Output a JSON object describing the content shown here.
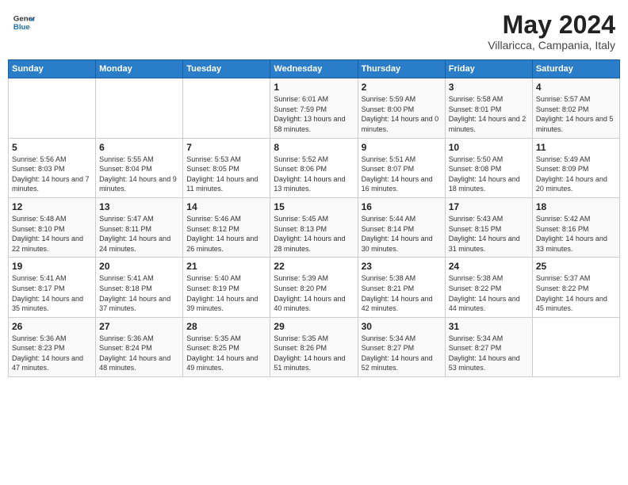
{
  "logo": {
    "general": "General",
    "blue": "Blue"
  },
  "title": "May 2024",
  "subtitle": "Villaricca, Campania, Italy",
  "headers": [
    "Sunday",
    "Monday",
    "Tuesday",
    "Wednesday",
    "Thursday",
    "Friday",
    "Saturday"
  ],
  "weeks": [
    [
      {
        "day": "",
        "sunrise": "",
        "sunset": "",
        "daylight": ""
      },
      {
        "day": "",
        "sunrise": "",
        "sunset": "",
        "daylight": ""
      },
      {
        "day": "",
        "sunrise": "",
        "sunset": "",
        "daylight": ""
      },
      {
        "day": "1",
        "sunrise": "Sunrise: 6:01 AM",
        "sunset": "Sunset: 7:59 PM",
        "daylight": "Daylight: 13 hours and 58 minutes."
      },
      {
        "day": "2",
        "sunrise": "Sunrise: 5:59 AM",
        "sunset": "Sunset: 8:00 PM",
        "daylight": "Daylight: 14 hours and 0 minutes."
      },
      {
        "day": "3",
        "sunrise": "Sunrise: 5:58 AM",
        "sunset": "Sunset: 8:01 PM",
        "daylight": "Daylight: 14 hours and 2 minutes."
      },
      {
        "day": "4",
        "sunrise": "Sunrise: 5:57 AM",
        "sunset": "Sunset: 8:02 PM",
        "daylight": "Daylight: 14 hours and 5 minutes."
      }
    ],
    [
      {
        "day": "5",
        "sunrise": "Sunrise: 5:56 AM",
        "sunset": "Sunset: 8:03 PM",
        "daylight": "Daylight: 14 hours and 7 minutes."
      },
      {
        "day": "6",
        "sunrise": "Sunrise: 5:55 AM",
        "sunset": "Sunset: 8:04 PM",
        "daylight": "Daylight: 14 hours and 9 minutes."
      },
      {
        "day": "7",
        "sunrise": "Sunrise: 5:53 AM",
        "sunset": "Sunset: 8:05 PM",
        "daylight": "Daylight: 14 hours and 11 minutes."
      },
      {
        "day": "8",
        "sunrise": "Sunrise: 5:52 AM",
        "sunset": "Sunset: 8:06 PM",
        "daylight": "Daylight: 14 hours and 13 minutes."
      },
      {
        "day": "9",
        "sunrise": "Sunrise: 5:51 AM",
        "sunset": "Sunset: 8:07 PM",
        "daylight": "Daylight: 14 hours and 16 minutes."
      },
      {
        "day": "10",
        "sunrise": "Sunrise: 5:50 AM",
        "sunset": "Sunset: 8:08 PM",
        "daylight": "Daylight: 14 hours and 18 minutes."
      },
      {
        "day": "11",
        "sunrise": "Sunrise: 5:49 AM",
        "sunset": "Sunset: 8:09 PM",
        "daylight": "Daylight: 14 hours and 20 minutes."
      }
    ],
    [
      {
        "day": "12",
        "sunrise": "Sunrise: 5:48 AM",
        "sunset": "Sunset: 8:10 PM",
        "daylight": "Daylight: 14 hours and 22 minutes."
      },
      {
        "day": "13",
        "sunrise": "Sunrise: 5:47 AM",
        "sunset": "Sunset: 8:11 PM",
        "daylight": "Daylight: 14 hours and 24 minutes."
      },
      {
        "day": "14",
        "sunrise": "Sunrise: 5:46 AM",
        "sunset": "Sunset: 8:12 PM",
        "daylight": "Daylight: 14 hours and 26 minutes."
      },
      {
        "day": "15",
        "sunrise": "Sunrise: 5:45 AM",
        "sunset": "Sunset: 8:13 PM",
        "daylight": "Daylight: 14 hours and 28 minutes."
      },
      {
        "day": "16",
        "sunrise": "Sunrise: 5:44 AM",
        "sunset": "Sunset: 8:14 PM",
        "daylight": "Daylight: 14 hours and 30 minutes."
      },
      {
        "day": "17",
        "sunrise": "Sunrise: 5:43 AM",
        "sunset": "Sunset: 8:15 PM",
        "daylight": "Daylight: 14 hours and 31 minutes."
      },
      {
        "day": "18",
        "sunrise": "Sunrise: 5:42 AM",
        "sunset": "Sunset: 8:16 PM",
        "daylight": "Daylight: 14 hours and 33 minutes."
      }
    ],
    [
      {
        "day": "19",
        "sunrise": "Sunrise: 5:41 AM",
        "sunset": "Sunset: 8:17 PM",
        "daylight": "Daylight: 14 hours and 35 minutes."
      },
      {
        "day": "20",
        "sunrise": "Sunrise: 5:41 AM",
        "sunset": "Sunset: 8:18 PM",
        "daylight": "Daylight: 14 hours and 37 minutes."
      },
      {
        "day": "21",
        "sunrise": "Sunrise: 5:40 AM",
        "sunset": "Sunset: 8:19 PM",
        "daylight": "Daylight: 14 hours and 39 minutes."
      },
      {
        "day": "22",
        "sunrise": "Sunrise: 5:39 AM",
        "sunset": "Sunset: 8:20 PM",
        "daylight": "Daylight: 14 hours and 40 minutes."
      },
      {
        "day": "23",
        "sunrise": "Sunrise: 5:38 AM",
        "sunset": "Sunset: 8:21 PM",
        "daylight": "Daylight: 14 hours and 42 minutes."
      },
      {
        "day": "24",
        "sunrise": "Sunrise: 5:38 AM",
        "sunset": "Sunset: 8:22 PM",
        "daylight": "Daylight: 14 hours and 44 minutes."
      },
      {
        "day": "25",
        "sunrise": "Sunrise: 5:37 AM",
        "sunset": "Sunset: 8:22 PM",
        "daylight": "Daylight: 14 hours and 45 minutes."
      }
    ],
    [
      {
        "day": "26",
        "sunrise": "Sunrise: 5:36 AM",
        "sunset": "Sunset: 8:23 PM",
        "daylight": "Daylight: 14 hours and 47 minutes."
      },
      {
        "day": "27",
        "sunrise": "Sunrise: 5:36 AM",
        "sunset": "Sunset: 8:24 PM",
        "daylight": "Daylight: 14 hours and 48 minutes."
      },
      {
        "day": "28",
        "sunrise": "Sunrise: 5:35 AM",
        "sunset": "Sunset: 8:25 PM",
        "daylight": "Daylight: 14 hours and 49 minutes."
      },
      {
        "day": "29",
        "sunrise": "Sunrise: 5:35 AM",
        "sunset": "Sunset: 8:26 PM",
        "daylight": "Daylight: 14 hours and 51 minutes."
      },
      {
        "day": "30",
        "sunrise": "Sunrise: 5:34 AM",
        "sunset": "Sunset: 8:27 PM",
        "daylight": "Daylight: 14 hours and 52 minutes."
      },
      {
        "day": "31",
        "sunrise": "Sunrise: 5:34 AM",
        "sunset": "Sunset: 8:27 PM",
        "daylight": "Daylight: 14 hours and 53 minutes."
      },
      {
        "day": "",
        "sunrise": "",
        "sunset": "",
        "daylight": ""
      }
    ]
  ]
}
